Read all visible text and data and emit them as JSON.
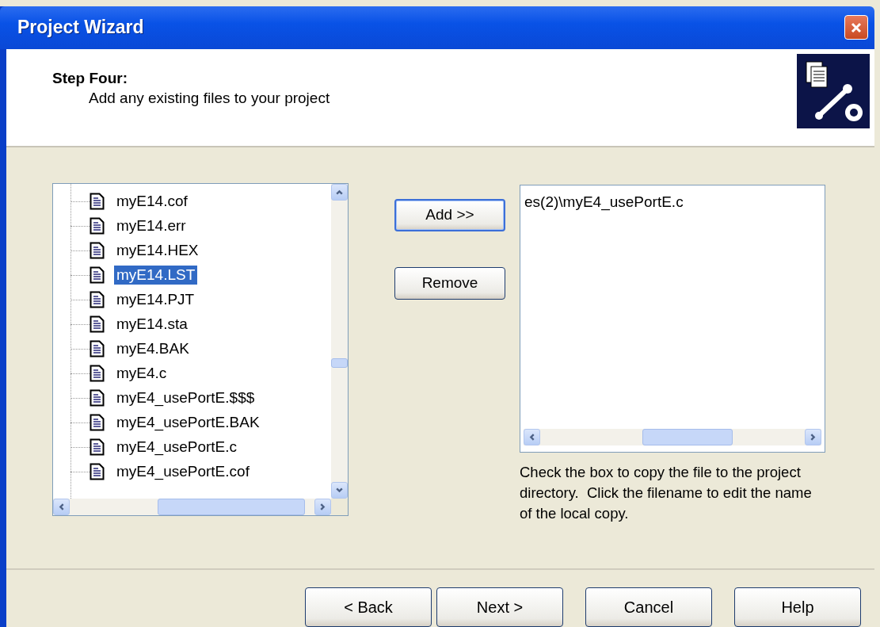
{
  "window": {
    "title": "Project Wizard"
  },
  "header": {
    "title": "Step Four:",
    "subtitle": "Add any existing files to your project"
  },
  "file_tree": {
    "items": [
      {
        "label": "myE14.cof",
        "selected": false
      },
      {
        "label": "myE14.err",
        "selected": false
      },
      {
        "label": "myE14.HEX",
        "selected": false
      },
      {
        "label": "myE14.LST",
        "selected": true
      },
      {
        "label": "myE14.PJT",
        "selected": false
      },
      {
        "label": "myE14.sta",
        "selected": false
      },
      {
        "label": "myE4.BAK",
        "selected": false
      },
      {
        "label": "myE4.c",
        "selected": false
      },
      {
        "label": "myE4_usePortE.$$$",
        "selected": false
      },
      {
        "label": "myE4_usePortE.BAK",
        "selected": false
      },
      {
        "label": "myE4_usePortE.c",
        "selected": false
      },
      {
        "label": "myE4_usePortE.cof",
        "selected": false
      }
    ]
  },
  "middle_buttons": [
    {
      "label": "Add >>",
      "focused": true
    },
    {
      "label": "Remove",
      "focused": false
    }
  ],
  "added_files": {
    "items": [
      "es(2)\\myE4_usePortE.c"
    ]
  },
  "hint": "Check the box to copy the file to the project directory.  Click the filename to edit the name of the local copy.",
  "footer_buttons": [
    {
      "label": "< Back",
      "kind": "nav"
    },
    {
      "label": "Next >",
      "kind": "nav"
    },
    {
      "label": "Cancel",
      "kind": "action"
    },
    {
      "label": "Help",
      "kind": "action"
    }
  ]
}
